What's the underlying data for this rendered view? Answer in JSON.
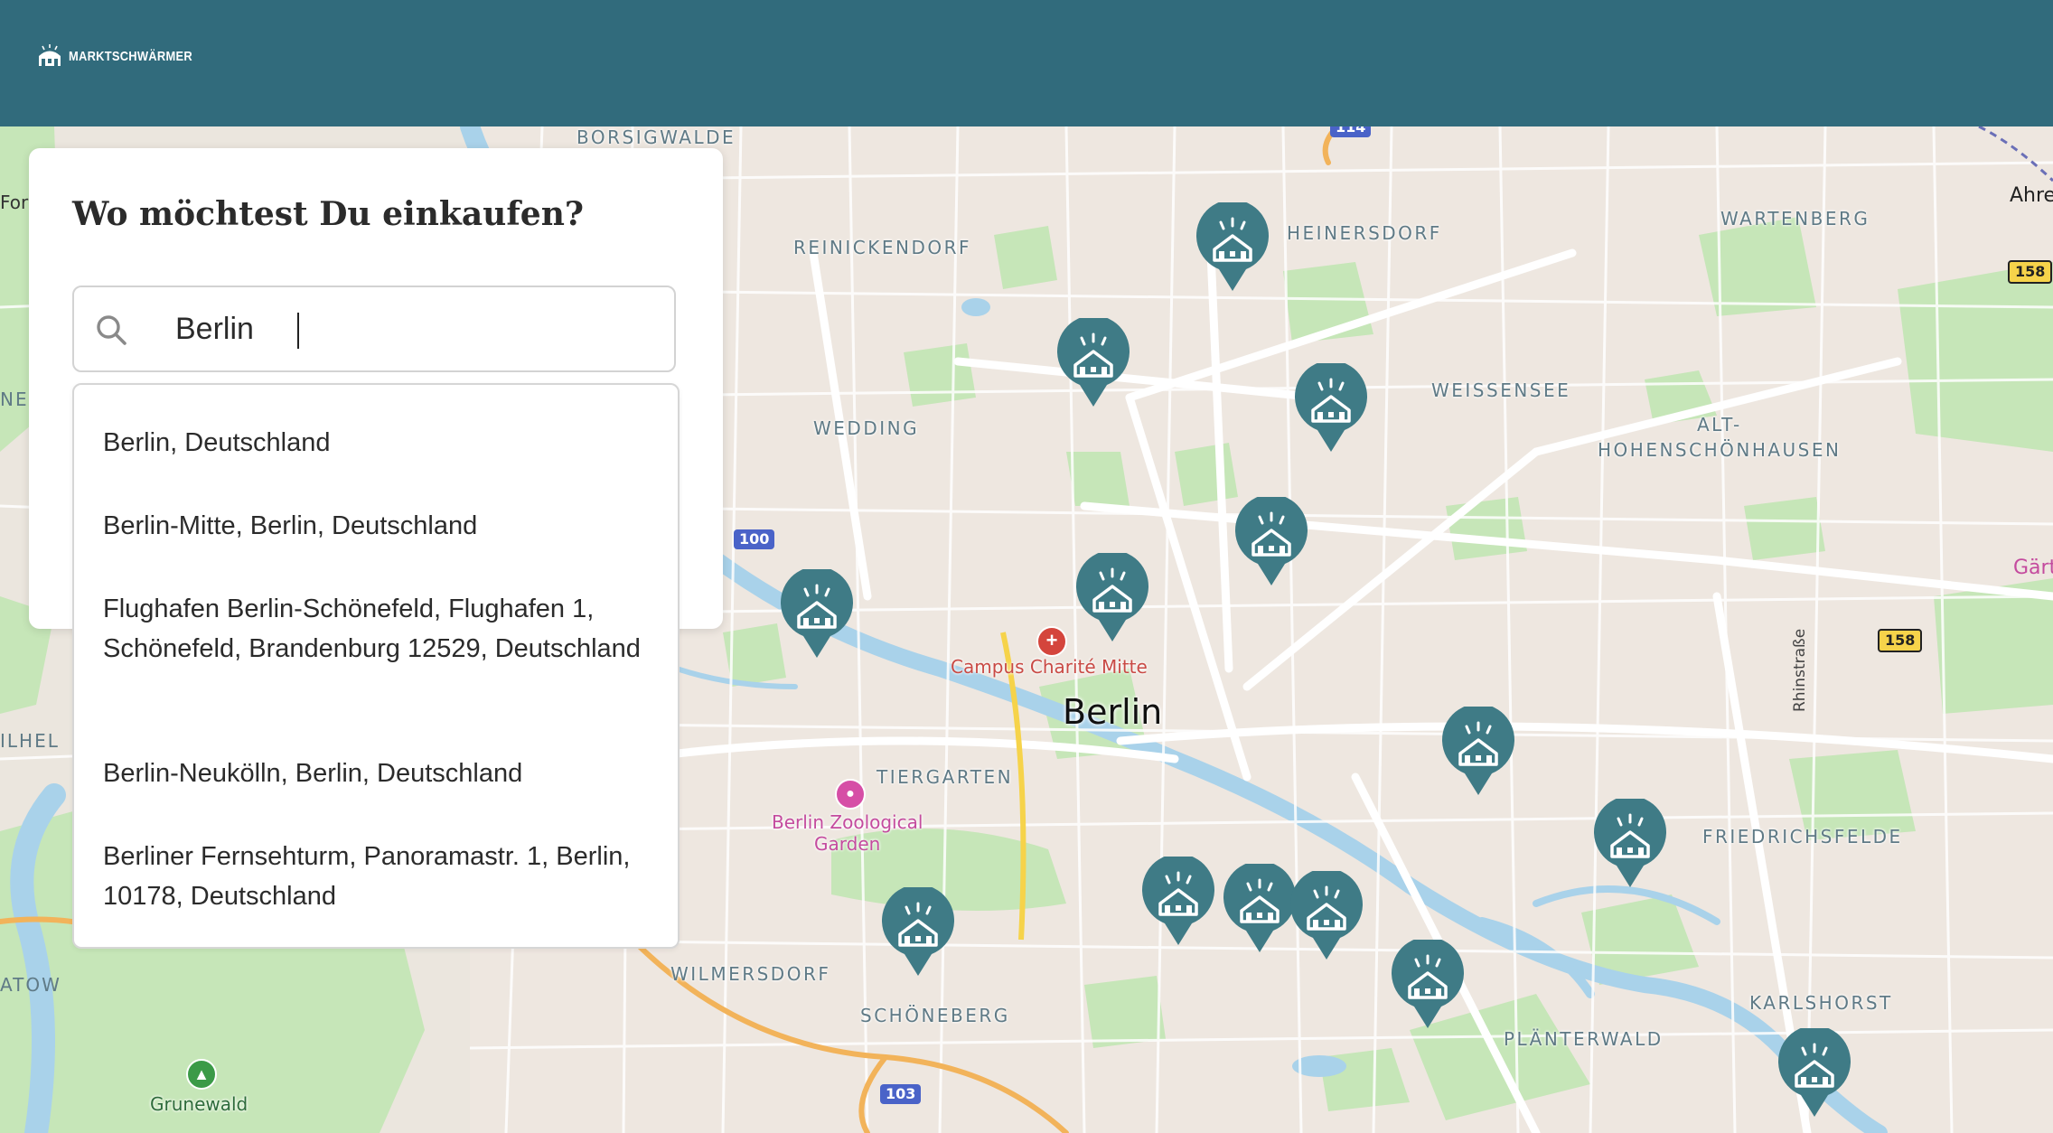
{
  "header": {
    "logo_text": "MARKTSCHWÄRMER"
  },
  "search_panel": {
    "title": "Wo möchtest Du einkaufen?",
    "search_value": "Berlin"
  },
  "suggestions": [
    "Berlin, Deutschland",
    "Berlin-Mitte, Berlin, Deutschland",
    "Flughafen Berlin-Schönefeld, Flughafen 1, Schönefeld, Brandenburg 12529, Deutschland",
    "Berlin-Neukölln, Berlin, Deutschland",
    "Berliner Fernsehturm, Panoramastr. 1, Berlin, 10178, Deutschland"
  ],
  "map": {
    "city_label": "Berlin",
    "districts": {
      "borsigwalde": "BORSIGWALDE",
      "reinickendorf": "REINICKENDORF",
      "heinersdorf": "HEINERSDORF",
      "wartenberg": "WARTENBERG",
      "weissensee": "WEISSENSEE",
      "wedding": "WEDDING",
      "alt_hohenschoenhausen_1": "ALT-",
      "alt_hohenschoenhausen_2": "HOHENSCHÖNHAUSEN",
      "tiergarten": "TIERGARTEN",
      "friedrichsfelde": "FRIEDRICHSFELDE",
      "wilmersdorf": "WILMERSDORF",
      "schoeneberg": "SCHÖNEBERG",
      "plaenterwald": "PLÄNTERWALD",
      "karlshorst": "KARLSHORST"
    },
    "pois": {
      "charite": "Campus Charité Mitte",
      "zoo_line1": "Berlin Zoological",
      "zoo_line2": "Garden",
      "grunewald": "Grunewald"
    },
    "road_badges": {
      "b100": "100",
      "b103": "103",
      "b114": "114",
      "b158_top": "158",
      "b158_mid": "158"
    },
    "street_labels": {
      "rhinstrasse": "Rhinstraße"
    },
    "edge_labels": {
      "ahre": "Ahre",
      "gaert": "Gärt",
      "for": "For",
      "ne": "NE",
      "ilhel": "ILHEL",
      "atow": "ATOW"
    },
    "colors": {
      "header": "#316b7c",
      "marker": "#3f7b86",
      "park": "#c6e6b8",
      "water": "#a9d2ea",
      "highway": "#f2b35a"
    }
  }
}
